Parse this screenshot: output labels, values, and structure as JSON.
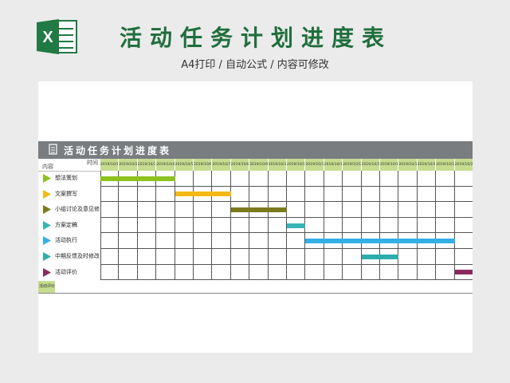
{
  "banner": {
    "title": "活动任务计划进度表",
    "subtitle": "A4打印 / 自动公式 / 内容可修改",
    "logo_letter": "X"
  },
  "sheet": {
    "title": "活动任务计划进度表",
    "corner_time": "时间",
    "corner_content": "内容",
    "footer": "活动评价"
  },
  "dates": [
    "2019/10/1",
    "2019/10/2",
    "2019/10/3",
    "2019/10/4",
    "2019/10/5",
    "2019/10/6",
    "2019/10/7",
    "2019/10/8",
    "2019/10/9",
    "2019/10/10",
    "2019/10/11",
    "2019/10/12",
    "2019/10/13",
    "2019/10/14",
    "2019/10/15",
    "2019/10/16",
    "2019/10/17",
    "2019/10/18",
    "2019/10/19",
    "2019/10/20"
  ],
  "tasks": [
    {
      "name": "想法策划",
      "arrow_color": "#8dc21f",
      "bar_color": "#8dc21f",
      "start": 0,
      "end": 4
    },
    {
      "name": "文案撰写",
      "arrow_color": "#f5b914",
      "bar_color": "#f5b914",
      "start": 4,
      "end": 7
    },
    {
      "name": "小组讨论及意见修",
      "arrow_color": "#7b7b1e",
      "bar_color": "#7b7b1e",
      "start": 7,
      "end": 10
    },
    {
      "name": "方案定稿",
      "arrow_color": "#37b5b5",
      "bar_color": "#37b5b5",
      "start": 10,
      "end": 11
    },
    {
      "name": "活动执行",
      "arrow_color": "#33b0e5",
      "bar_color": "#33b0e5",
      "start": 11,
      "end": 19
    },
    {
      "name": "中期反馈及时修改",
      "arrow_color": "#2eadad",
      "bar_color": "#2eadad",
      "start": 14,
      "end": 16
    },
    {
      "name": "活动评价",
      "arrow_color": "#8b2a5e",
      "bar_color": "#8b2a5e",
      "start": 19,
      "end": 20
    }
  ],
  "colors": {
    "brand_green": "#1f6e3d",
    "header_gray": "#7a7d80",
    "date_bg": "#c6dd8f"
  }
}
